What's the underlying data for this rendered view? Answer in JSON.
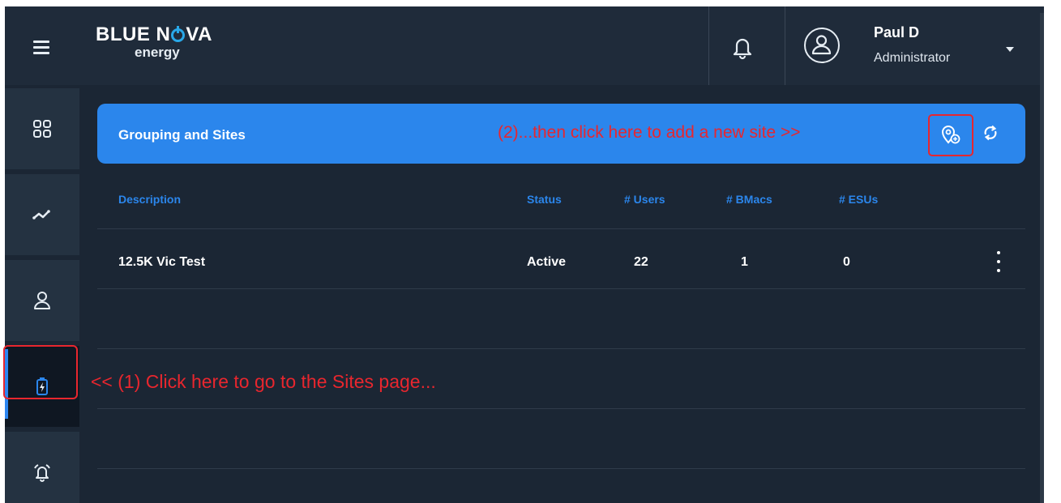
{
  "app": {
    "logo_main_left": "BLUE N",
    "logo_main_right": "VA",
    "logo_sub": "energy"
  },
  "user": {
    "name": "Paul D",
    "role": "Administrator"
  },
  "sidebar": {
    "items": [
      {
        "icon": "dashboard-grid-icon"
      },
      {
        "icon": "activity-chart-icon"
      },
      {
        "icon": "user-icon"
      },
      {
        "icon": "battery-icon",
        "active": true
      },
      {
        "icon": "alarm-bell-icon"
      }
    ]
  },
  "panel": {
    "title": "Grouping and Sites",
    "add_site_icon": "add-location-icon",
    "refresh_icon": "refresh-icon"
  },
  "table": {
    "columns": [
      "Description",
      "Status",
      "# Users",
      "# BMacs",
      "# ESUs"
    ],
    "rows": [
      {
        "description": "12.5K Vic Test",
        "status": "Active",
        "users": "22",
        "bmacs": "1",
        "esus": "0"
      }
    ]
  },
  "annotations": {
    "step1": "<< (1) Click here to go to the Sites page...",
    "step2": "(2)...then click here to add a new site >>"
  },
  "colors": {
    "accent": "#2b86ec",
    "background": "#1b2634",
    "annotation": "#e8262e"
  }
}
